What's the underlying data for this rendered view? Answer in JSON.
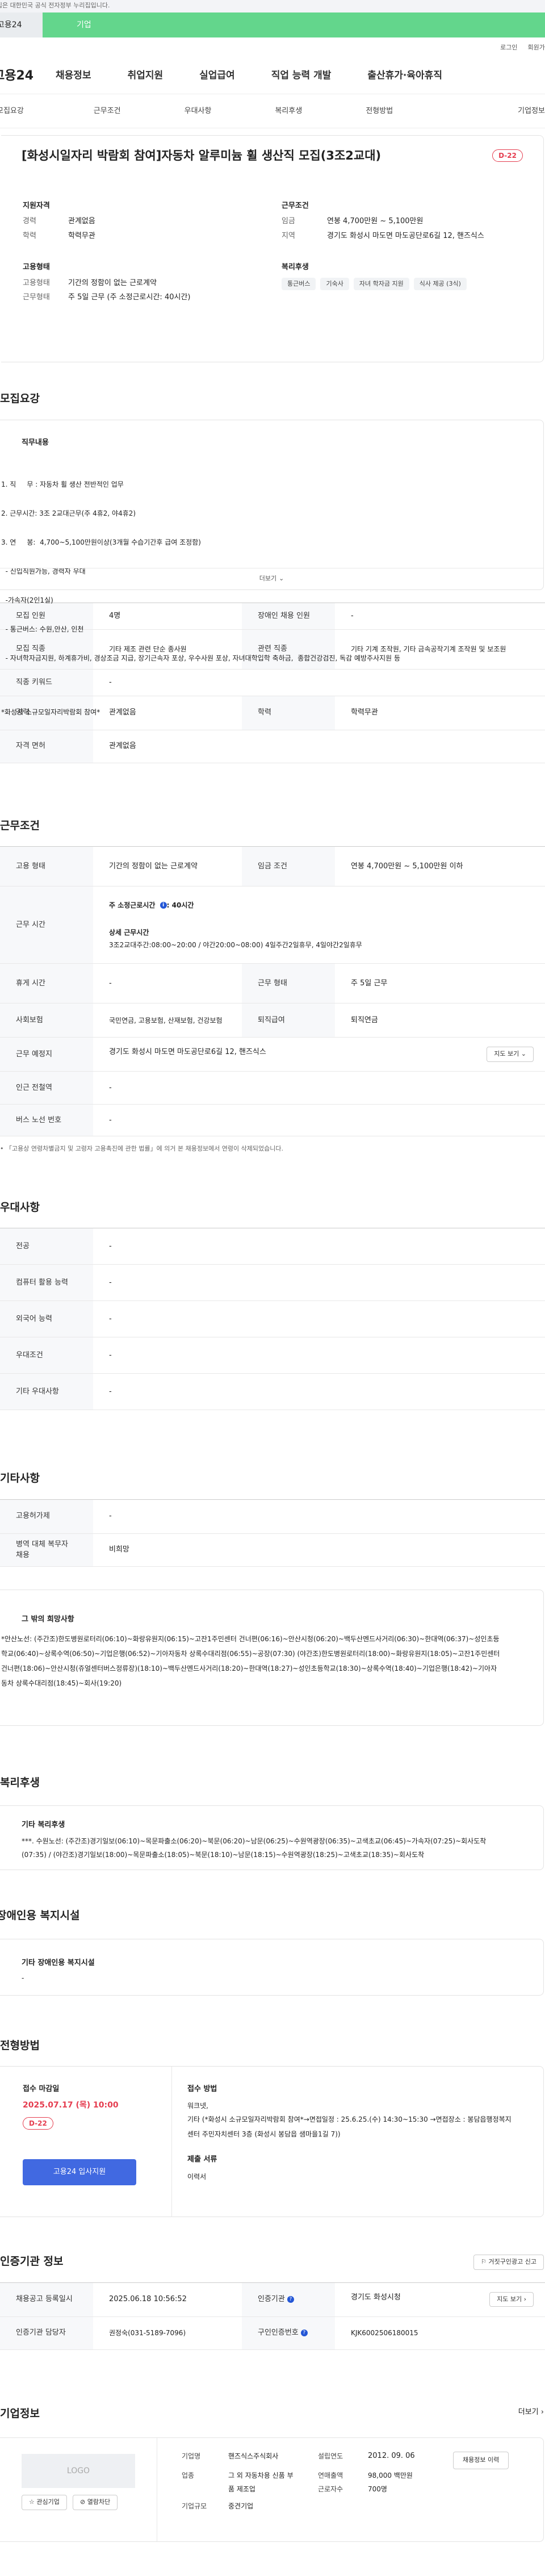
{
  "banner": {
    "text": "이 누리집은 대한민국 공식 전자정부 누리집입니다."
  },
  "tabs": {
    "left": "고용24",
    "right": "기업"
  },
  "utility": {
    "login": "로그인",
    "join": "회원가입"
  },
  "gnb": {
    "logo": "고용24",
    "items": [
      "채용정보",
      "취업지원",
      "실업급여",
      "직업 능력 개발",
      "출산휴가·육아휴직"
    ]
  },
  "lnb": {
    "items": [
      "모집요강",
      "근무조건",
      "우대사항",
      "복리후생",
      "전형방법",
      "기업정보"
    ]
  },
  "hero": {
    "title": "[화성시일자리 박람회 참여]자동차 알루미늄 휠 생산직 모집(3조2교대)",
    "dday": "D-22",
    "qualification": {
      "heading": "지원자격",
      "rows": [
        {
          "k": "경력",
          "v": "관계없음"
        },
        {
          "k": "학력",
          "v": "학력무관"
        }
      ]
    },
    "conditions": {
      "heading": "근무조건",
      "rows": [
        {
          "k": "임금",
          "v": "연봉 4,700만원 ~ 5,100만원"
        },
        {
          "k": "지역",
          "v": "경기도 화성시 마도면 마도공단로6길 12, 핸즈식스"
        }
      ]
    },
    "employment": {
      "heading": "고용형태",
      "rows": [
        {
          "k": "고용형태",
          "v": "기간의 정함이 없는 근로계약"
        },
        {
          "k": "근무형태",
          "v": "주 5일 근무 (주 소정근로시간: 40시간)"
        }
      ]
    },
    "welfare": {
      "heading": "복리후생",
      "badges": [
        "통근버스",
        "기숙사",
        "자녀 학자금 지원",
        "식사 제공 (3식)"
      ]
    }
  },
  "recruit": {
    "title": "모집요강",
    "desc_heading": "직무내용",
    "lines": [
      "1. 직     무 : 자동차 휠 생산 전반적인 업무",
      "2. 근무시간: 3조 2교대근무(주 4휴2, 야4휴2)",
      "3. 연     봉:  4,700~5,100만원이상(3개월 수습기간후 급여 조정함)",
      "  - 신입직원가능, 경력자 우대",
      "  -가속자(2인1실)",
      "  - 통근버스: 수원,안산, 인천",
      "  - 자녀학자금지원, 하계휴가비, 경상조금 지급, 장기근속자 포상, 우수사원 포상, 자녀대학입학 축하금,  종합건강검진, 독감 예방주사지원 등",
      "",
      "*화성시 소규모일자리박람회 참여*"
    ],
    "more": "더보기",
    "rows": [
      {
        "k1": "모집 인원",
        "v1": "4명",
        "k2": "장애인 채용 인원",
        "v2": "-"
      },
      {
        "k1": "모집 직종",
        "v1": "기타 제조 관련 단순 종사원",
        "k2": "관련 직종",
        "v2": "기타 기계 조작원, 기타 금속공작기계 조작원 및 보조원"
      },
      {
        "k1": "직종 키워드",
        "v1": "-"
      },
      {
        "k1": "경력",
        "v1": "관계없음",
        "k2": "학력",
        "v2": "학력무관"
      },
      {
        "k1": "자격 면허",
        "v1": "관계없음"
      }
    ]
  },
  "work": {
    "title": "근무조건",
    "employment_type": {
      "k": "고용 형태",
      "v": "기간의 정함이 없는 근로계약",
      "k2": "임금 조건",
      "v2": "연봉 4,700만원 ~ 5,100만원 이하"
    },
    "work_time": {
      "k": "근무 시간",
      "weekly_label": "주 소정근로시간",
      "weekly_value": "40시간",
      "detail_label": "상세 근무시간",
      "detail": "3조2교대주간:08:00~20:00 / 야간20:00~08:00) 4일주간2일휴무, 4일야간2일휴무"
    },
    "rest": {
      "k": "휴게 시간",
      "v": "-",
      "k2": "근무 형태",
      "v2": "주 5일 근무"
    },
    "insurance": {
      "k": "사회보험",
      "v": "국민연금, 고용보험, 산재보험, 건강보험",
      "k2": "퇴직급여",
      "v2": "퇴직연금"
    },
    "location": {
      "k": "근무 예정지",
      "v": "경기도 화성시 마도면 마도공단로6길 12, 핸즈식스",
      "btn": "지도 보기"
    },
    "station": {
      "k": "인근 전철역",
      "v": "-"
    },
    "bus": {
      "k": "버스 노선 번호",
      "v": "-"
    },
    "note": "「고용상 연령차별금지 및 고령자 고용촉진에 관한 법률」에 의거 본 채용정보에서 연령이 삭제되었습니다."
  },
  "pref": {
    "title": "우대사항",
    "rows": [
      {
        "k": "전공",
        "v": "-"
      },
      {
        "k": "컴퓨터 활용 능력",
        "v": "-"
      },
      {
        "k": "외국어 능력",
        "v": "-"
      },
      {
        "k": "우대조건",
        "v": "-"
      },
      {
        "k": "기타 우대사항",
        "v": "-"
      }
    ]
  },
  "etc": {
    "title": "기타사항",
    "rows": [
      {
        "k": "고용허가제",
        "v": "-"
      },
      {
        "k": "병역 대체 복무자 채용",
        "v": "비희망"
      }
    ],
    "other_heading": "그 밖의 희망사항",
    "other_text": "*안산노선: (주간조)한도병원로터리(06:10)~화랑유원지(06:15)~고잔1주민센터 건너편(06:16)~안산시청(06:20)~백두산멘드사거리(06:30)~한대역(06:37)~성인초등학교(06:40)~상록수역(06:50)~기업은행(06:52)~기아자동차 상록수대리점(06:55)~공장(07:30) (야간조)한도병원로터리(18:00)~화랑유원지(18:05)~고잔1주민센터 건너편(18:06)~안산시청(쥬얼센터버스정류장)(18:10)~백두산멘드사거리(18:20)~한대역(18:27)~성인초등학교(18:30)~상록수역(18:40)~기업은행(18:42)~기아자동차 상록수대리점(18:45)~회사(19:20)"
  },
  "welfare": {
    "title": "복리후생",
    "heading": "기타 복리후생",
    "text": "***. 수원노선: (주간조)경기일보(06:10)~목문파출소(06:20)~북문(06:20)~남문(06:25)~수원역광장(06:35)~고색초교(06:45)~가속자(07:25)~회사도착(07:35) / (야간조)경기일보(18:00)~목문파출소(18:05)~북문(18:10)~남문(18:15)~수원역광장(18:25)~고색초교(18:35)~회사도착"
  },
  "disabled": {
    "title": "장애인용 복지시설",
    "heading": "기타 장애인용 복지시설",
    "text": "-"
  },
  "process": {
    "title": "전형방법",
    "deadline_label": "접수 마감일",
    "deadline": "2025.07.17 (목) 10:00",
    "dday": "D-22",
    "apply_btn": "고용24 입사지원",
    "method_label": "접수 방법",
    "method_line1": "워크넷,",
    "method_line2": "기타 (*화성시 소규모일자리박람회 참여*→면접일정 : 25.6.25.(수) 14:30~15:30 →면접장소 : 봉담읍행정복지센터 주민자치센터 3층 (화성시 봉담읍 샘마을1길 7))",
    "docs_label": "제출 서류",
    "docs": "이력서"
  },
  "agency": {
    "title": "인증기관 정보",
    "report_btn": "거짓구인광고 신고",
    "reg_date_k": "채용공고 등록일시",
    "reg_date_v": "2025.06.18 10:56:52",
    "agency_k": "인증기관",
    "agency_v": "경기도 화성시청",
    "map_btn": "지도 보기",
    "manager_k": "인증기관 담당자",
    "manager_v": "권정숙(031-5189-7096)",
    "reg_no_k": "구인인증번호",
    "reg_no_v": "KJK6002506180015"
  },
  "company": {
    "title": "기업정보",
    "more": "더보기",
    "logo": "LOGO",
    "fav_btn": "관심기업",
    "block_btn": "열람차단",
    "name_k": "기업명",
    "name_v": "핸즈식스주식회사",
    "year_k": "설립연도",
    "year_v": "2012. 09. 06",
    "hire_btn": "채용정보 이력",
    "industry_k": "업종",
    "industry_v": "그 외 자동차용 신품 부품 제조업",
    "sales_k": "연매출액",
    "sales_v": "98,000 백만원",
    "staff_k": "근로자수",
    "staff_v": "700명",
    "size_k": "기업규모",
    "size_v": "중견기업"
  }
}
